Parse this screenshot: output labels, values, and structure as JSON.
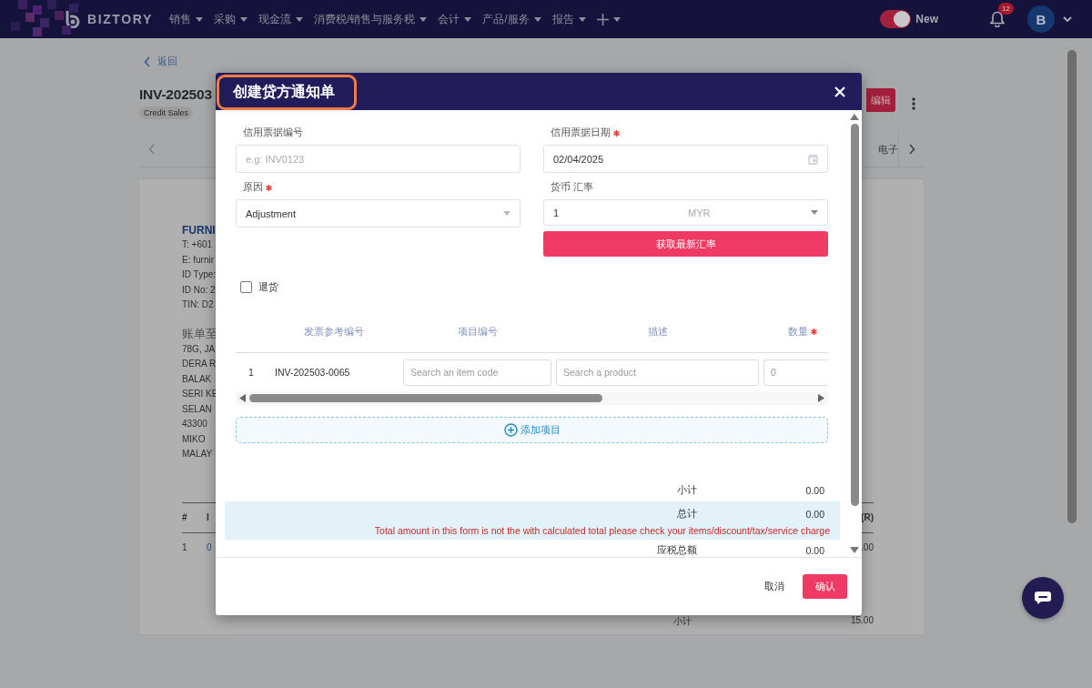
{
  "navbar": {
    "logo": "BIZTORY",
    "menus": [
      "销售",
      "采购",
      "现金流",
      "消费税/销售与服务税",
      "会计",
      "产品/服务",
      "报告"
    ],
    "new_toggle": {
      "label": "New",
      "on": true
    },
    "notification_count": "12",
    "avatar": "B"
  },
  "page": {
    "back_link": "返回",
    "title": "INV-202503",
    "badge": "Credit Sales",
    "edit_button": "编辑",
    "tab_partial": "电子",
    "sender": {
      "name": "FURNI",
      "lines": [
        "T: +601",
        "E: furnir",
        "ID Type:",
        "ID No: 2",
        "TIN: D2"
      ]
    },
    "bill_to": {
      "heading": "账单至",
      "lines": [
        "78G, JA",
        "DERA R",
        "BALAK",
        "SERI KE",
        "SELAN",
        "43300",
        "MIKO",
        "MALAY"
      ]
    },
    "table": {
      "columns": [
        "#",
        "I",
        "(R)"
      ],
      "rows": [
        [
          "1",
          "0",
          ".00"
        ]
      ]
    },
    "subtotal": {
      "label": "小计",
      "value": "15.00"
    }
  },
  "modal": {
    "title": "创建贷方通知单",
    "credit_note_no": {
      "label": "信用票据编号",
      "placeholder": "e.g: INV0123"
    },
    "credit_note_date": {
      "label": "信用票据日期",
      "value": "02/04/2025",
      "required": true
    },
    "reason": {
      "label": "原因",
      "value": "Adjustment",
      "required": true
    },
    "currency": {
      "label": "货币 汇率",
      "rate": "1",
      "currency": "MYR"
    },
    "fetch_rate_button": "获取最新汇率",
    "return_goods": {
      "label": "退货",
      "checked": false
    },
    "item_columns": [
      {
        "label": "发票参考编号",
        "required": false
      },
      {
        "label": "项目编号",
        "required": false
      },
      {
        "label": "描述",
        "required": false
      },
      {
        "label": "数量",
        "required": true
      }
    ],
    "item_rows": [
      {
        "index": "1",
        "invoice_ref": "INV-202503-0065",
        "item_code_placeholder": "Search an item code",
        "product_placeholder": "Search a product",
        "quantity_placeholder": "0"
      }
    ],
    "add_item_button": "添加项目",
    "subtotal": {
      "label": "小计",
      "value": "0.00"
    },
    "total": {
      "label": "总计",
      "value": "0.00",
      "warning": "Total amount in this form is not the with calculated total please check your items/discount/tax/service charge"
    },
    "taxable_total": {
      "label": "应税总额",
      "value": "0.00"
    },
    "cancel_button": "取消",
    "confirm_button": "确认"
  }
}
